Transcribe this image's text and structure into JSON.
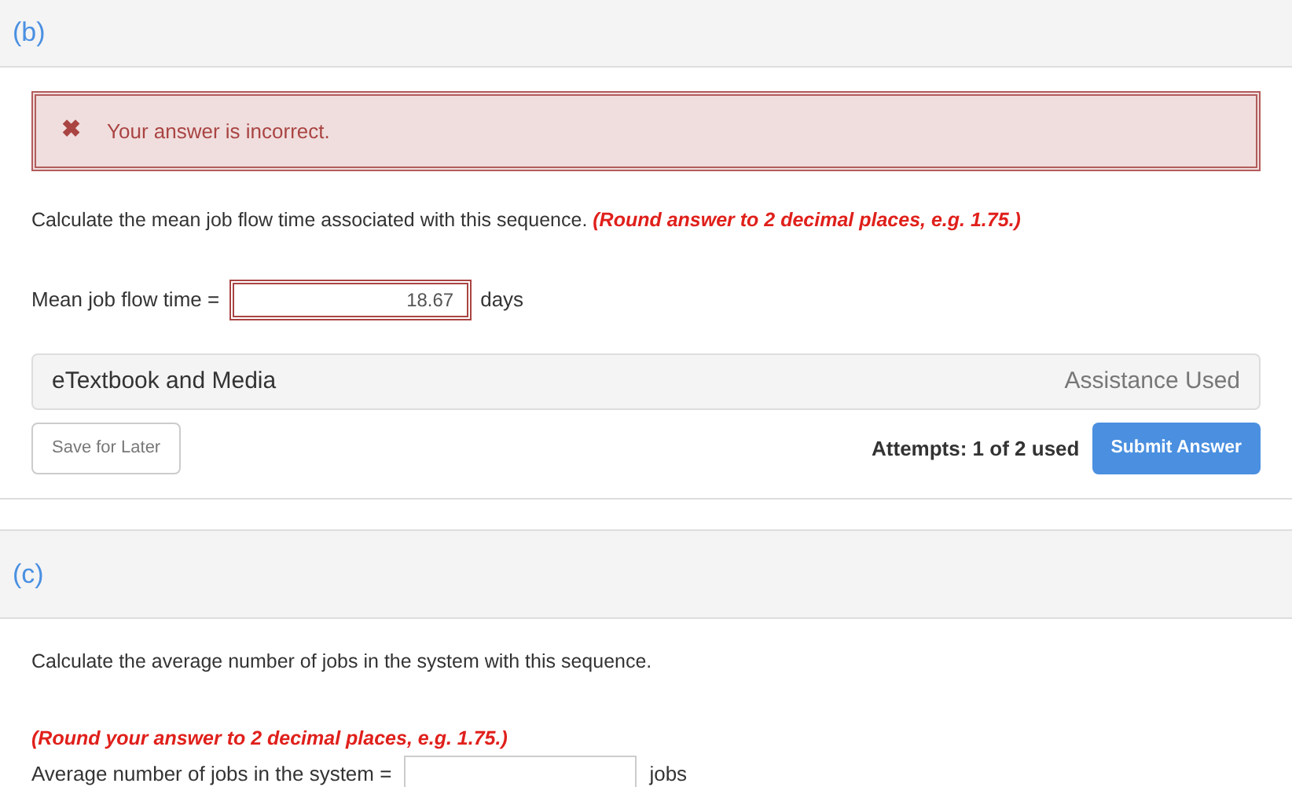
{
  "part_b": {
    "label": "(b)",
    "feedback": {
      "kind": "incorrect",
      "icon": "✖",
      "text": "Your answer is incorrect."
    },
    "question": "Calculate the mean job flow time associated with this sequence. ",
    "hint": "(Round answer to 2 decimal places, e.g. 1.75.)",
    "field": {
      "label": "Mean job flow time =",
      "value": "18.67",
      "unit": "days",
      "incorrect": true
    },
    "assistance": {
      "title": "eTextbook and Media",
      "status": "Assistance Used"
    },
    "save_button": "Save for Later",
    "attempts": "Attempts: 1 of 2 used",
    "submit_button": "Submit Answer"
  },
  "part_c": {
    "label": "(c)",
    "question": "Calculate the average number of jobs in the system with this sequence.",
    "hint": "(Round your answer to 2 decimal places, e.g. 1.75.)",
    "field": {
      "label": "Average number of jobs in the system =",
      "unit": "jobs",
      "incorrect": false
    }
  }
}
